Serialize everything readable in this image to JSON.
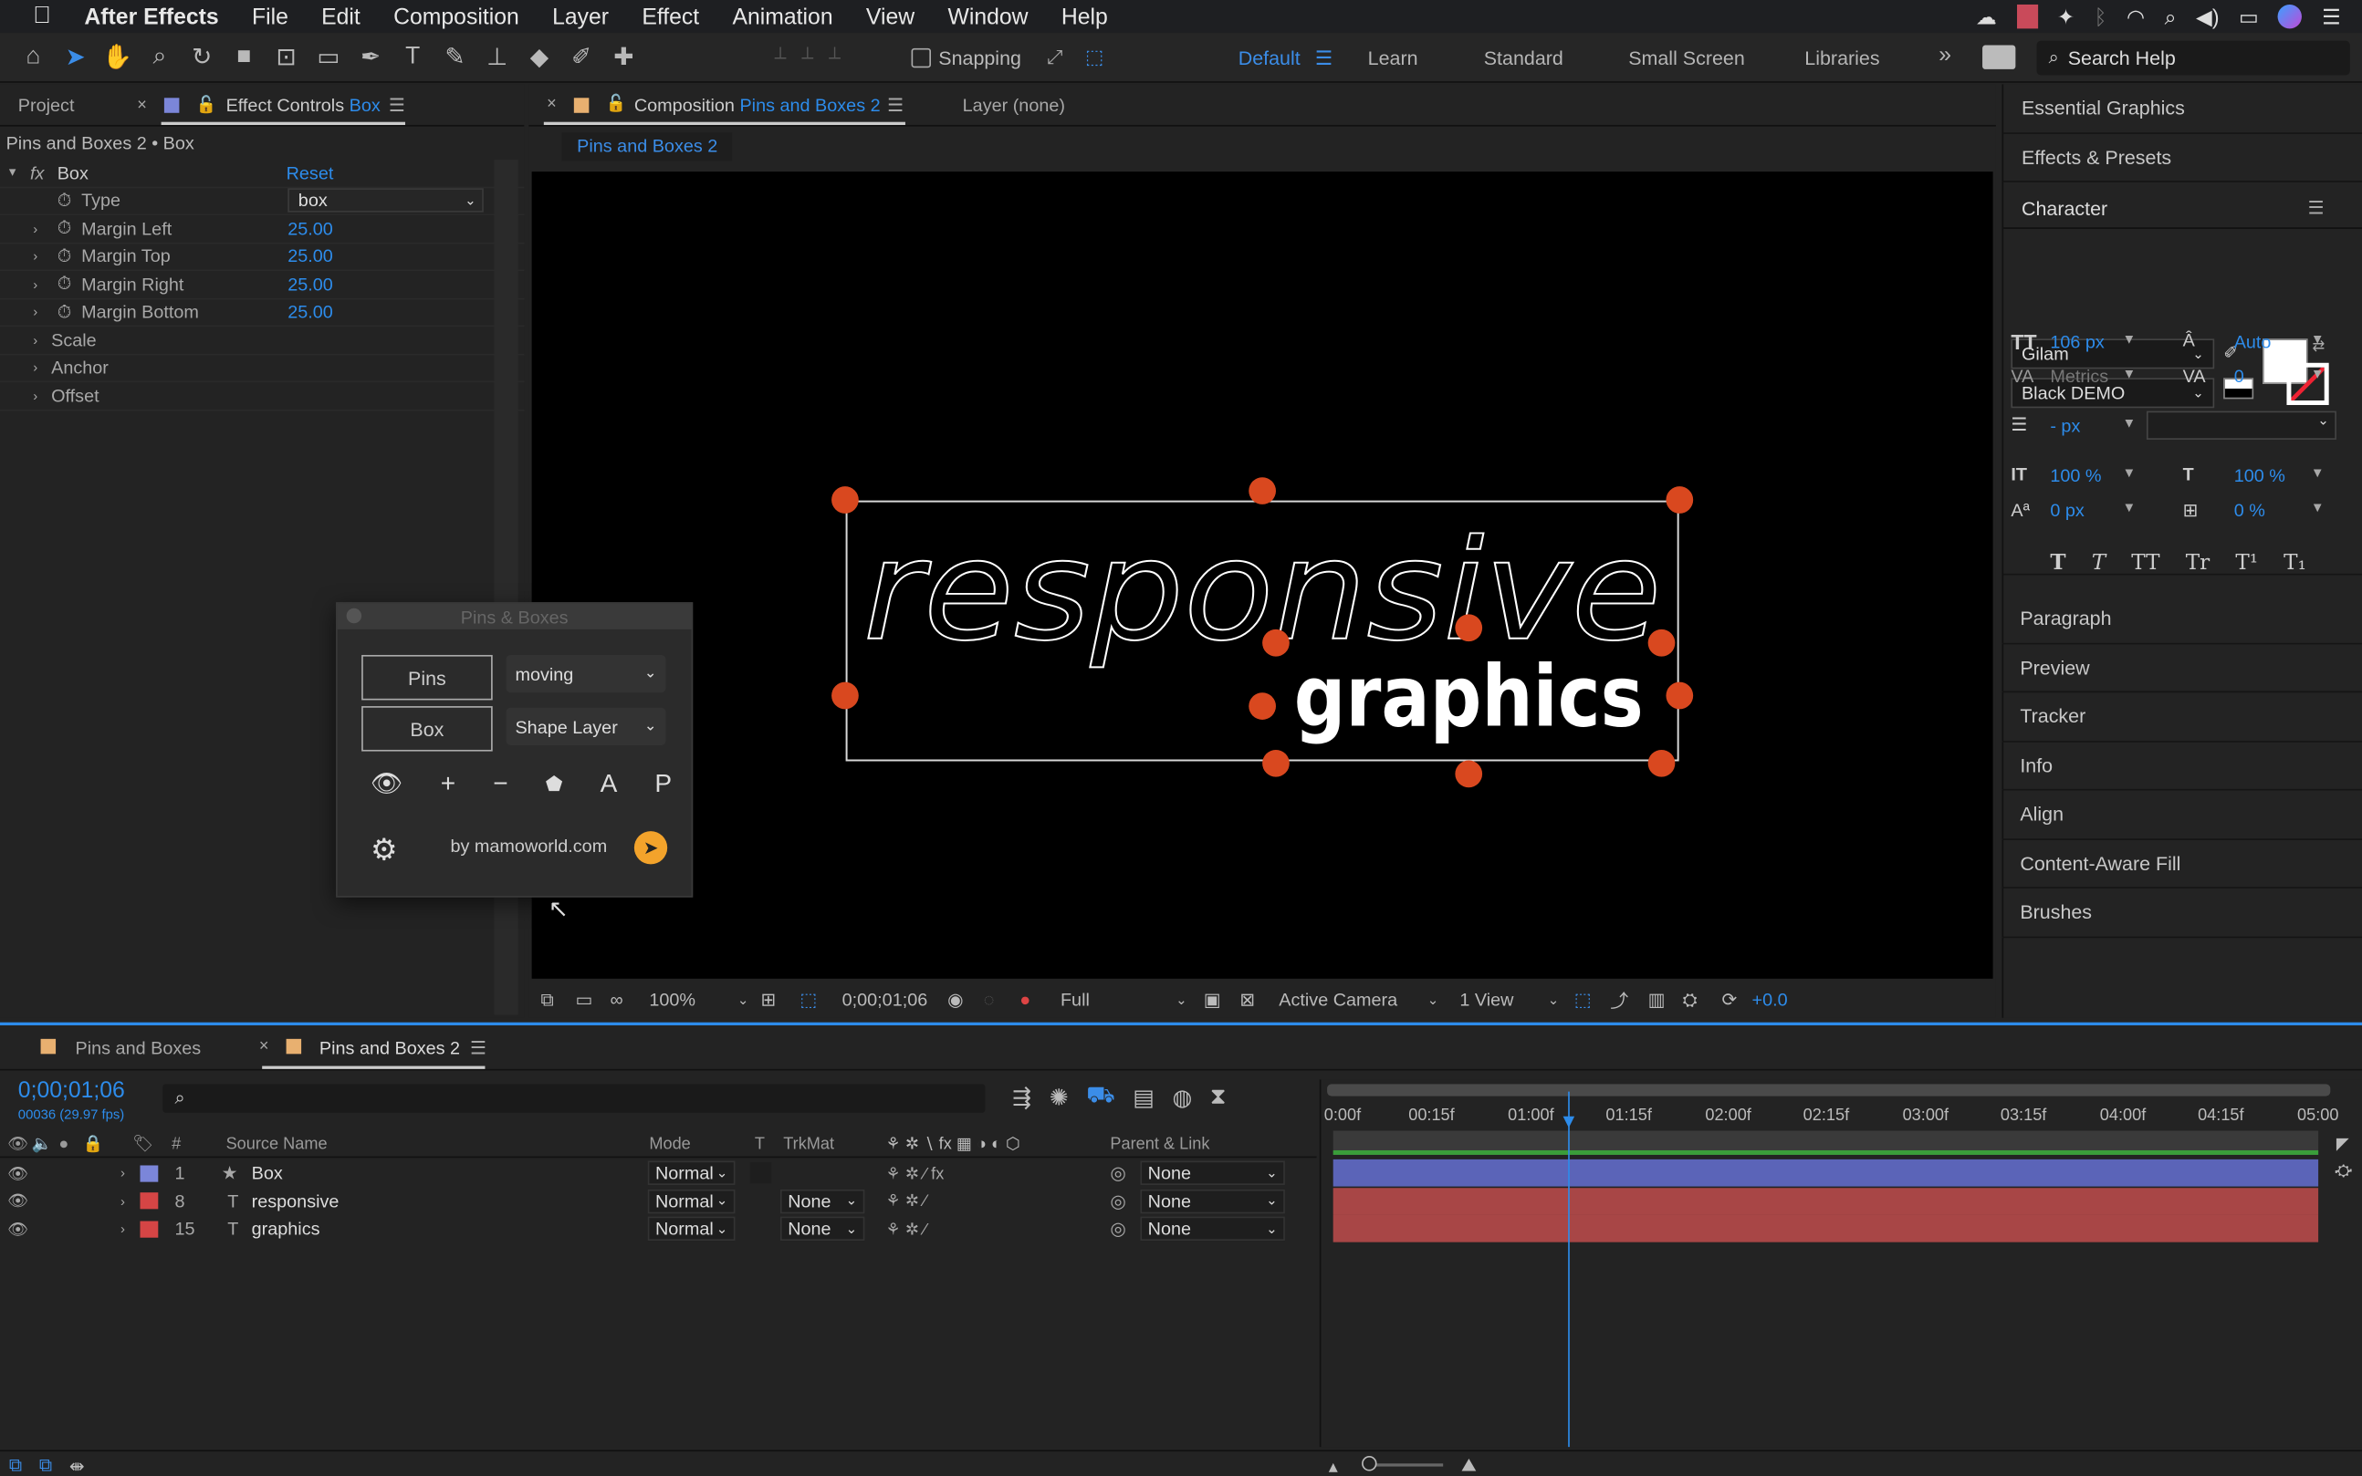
{
  "menubar": {
    "app": "After Effects",
    "items": [
      "File",
      "Edit",
      "Composition",
      "Layer",
      "Effect",
      "Animation",
      "View",
      "Window",
      "Help"
    ]
  },
  "toolbar": {
    "snapping": "Snapping",
    "workspaces": [
      "Default",
      "Learn",
      "Standard",
      "Small Screen",
      "Libraries"
    ],
    "search_placeholder": "Search Help"
  },
  "left_panel": {
    "tab_project": "Project",
    "tab_effect_controls": "Effect Controls",
    "tab_effect_target": "Box",
    "breadcrumb": "Pins and Boxes 2 • Box",
    "effect_name": "Box",
    "reset_label": "Reset",
    "type_label": "Type",
    "type_value": "box",
    "props": [
      {
        "label": "Margin Left",
        "value": "25.00"
      },
      {
        "label": "Margin Top",
        "value": "25.00"
      },
      {
        "label": "Margin Right",
        "value": "25.00"
      },
      {
        "label": "Margin Bottom",
        "value": "25.00"
      }
    ],
    "groups": [
      "Scale",
      "Anchor",
      "Offset"
    ]
  },
  "pins_panel": {
    "title": "Pins & Boxes",
    "pins_button": "Pins",
    "box_button": "Box",
    "pins_mode": "moving",
    "box_type": "Shape Layer",
    "letter_a": "A",
    "letter_p": "P",
    "credit": "by mamoworld.com"
  },
  "comp_panel": {
    "tab_prefix": "Composition",
    "comp_name": "Pins and Boxes 2",
    "layer_tab": "Layer (none)",
    "subtab": "Pins and Boxes 2",
    "art": {
      "word1": "responsive",
      "word2": "graphics"
    },
    "footer": {
      "zoom": "100%",
      "timecode": "0;00;01;06",
      "resolution": "Full",
      "camera": "Active Camera",
      "views": "1 View",
      "exposure": "+0.0"
    }
  },
  "right_panel": {
    "sections_top": [
      "Essential Graphics",
      "Effects & Presets"
    ],
    "character": {
      "title": "Character",
      "font": "Gilam",
      "style": "Black DEMO",
      "size": "106 px",
      "leading": "Auto",
      "kerning": "Metrics",
      "tracking": "0",
      "stroke": "- px",
      "vscale": "100 %",
      "hscale": "100 %",
      "baseline": "0 px",
      "tsume": "0 %",
      "styles": [
        "T",
        "T",
        "TT",
        "Tr",
        "T¹",
        "T₁"
      ]
    },
    "sections_bottom": [
      "Paragraph",
      "Preview",
      "Tracker",
      "Info",
      "Align",
      "Content-Aware Fill",
      "Brushes"
    ]
  },
  "timeline": {
    "tabs": [
      "Pins and Boxes",
      "Pins and Boxes 2"
    ],
    "timecode": "0;00;01;06",
    "frames": "00036 (29.97 fps)",
    "headers": {
      "num": "#",
      "source": "Source Name",
      "mode": "Mode",
      "t": "T",
      "trkmat": "TrkMat",
      "parent": "Parent & Link"
    },
    "ruler": [
      "0:00f",
      "00:15f",
      "01:00f",
      "01:15f",
      "02:00f",
      "02:15f",
      "03:00f",
      "03:15f",
      "04:00f",
      "04:15f",
      "05:00"
    ],
    "layers": [
      {
        "num": "1",
        "type_icon": "★",
        "name": "Box",
        "mode": "Normal",
        "trkmat": "",
        "parent": "None",
        "color": "#7b86d9",
        "bar": "#5b64b8"
      },
      {
        "num": "8",
        "type_icon": "T",
        "name": "responsive",
        "mode": "Normal",
        "trkmat": "None",
        "parent": "None",
        "color": "#d54545",
        "bar": "#a84646"
      },
      {
        "num": "15",
        "type_icon": "T",
        "name": "graphics",
        "mode": "Normal",
        "trkmat": "None",
        "parent": "None",
        "color": "#d54545",
        "bar": "#a84646"
      }
    ]
  }
}
